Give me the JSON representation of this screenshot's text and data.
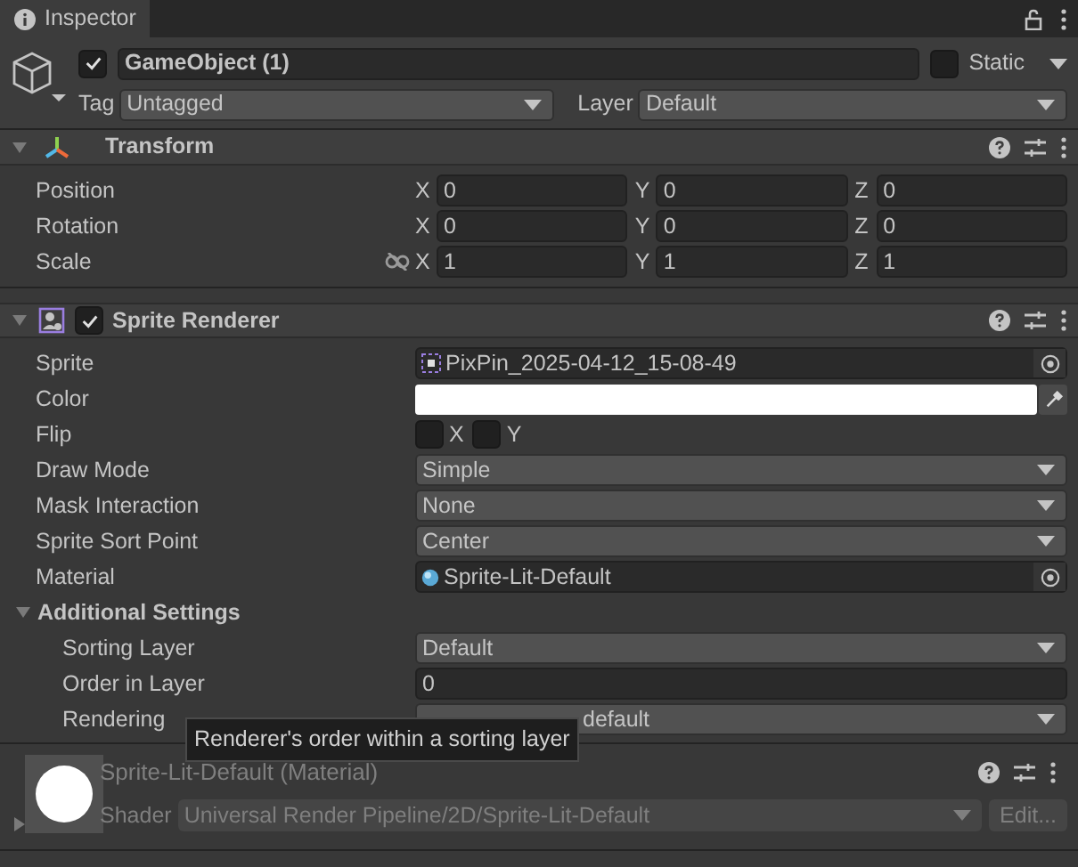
{
  "tab": {
    "title": "Inspector",
    "selected": true
  },
  "object": {
    "active": true,
    "name": "GameObject (1)",
    "static": false,
    "static_label": "Static",
    "tag_label": "Tag",
    "tag": "Untagged",
    "layer_label": "Layer",
    "layer": "Default"
  },
  "transform": {
    "title": "Transform",
    "expanded": true,
    "rows": [
      {
        "label": "Position",
        "linked": false,
        "axes": [
          {
            "axis": "X",
            "value": "0"
          },
          {
            "axis": "Y",
            "value": "0"
          },
          {
            "axis": "Z",
            "value": "0"
          }
        ]
      },
      {
        "label": "Rotation",
        "linked": false,
        "axes": [
          {
            "axis": "X",
            "value": "0"
          },
          {
            "axis": "Y",
            "value": "0"
          },
          {
            "axis": "Z",
            "value": "0"
          }
        ]
      },
      {
        "label": "Scale",
        "linked": true,
        "axes": [
          {
            "axis": "X",
            "value": "1"
          },
          {
            "axis": "Y",
            "value": "1"
          },
          {
            "axis": "Z",
            "value": "1"
          }
        ]
      }
    ]
  },
  "sprite_renderer": {
    "title": "Sprite Renderer",
    "enabled": true,
    "expanded": true,
    "rows": [
      {
        "kind": "object",
        "label": "Sprite",
        "value": "PixPin_2025-04-12_15-08-49"
      },
      {
        "kind": "color",
        "label": "Color",
        "color": "#ffffff"
      },
      {
        "kind": "flip",
        "label": "Flip",
        "toggles": [
          {
            "axis": "X",
            "checked": false
          },
          {
            "axis": "Y",
            "checked": false
          }
        ]
      },
      {
        "kind": "dropdown",
        "label": "Draw Mode",
        "value": "Simple"
      },
      {
        "kind": "dropdown",
        "label": "Mask Interaction",
        "value": "None"
      },
      {
        "kind": "dropdown",
        "label": "Sprite Sort Point",
        "value": "Center"
      },
      {
        "kind": "material",
        "label": "Material",
        "value": "Sprite-Lit-Default"
      },
      {
        "kind": "section",
        "label": "Additional Settings",
        "expanded": true,
        "children": [
          {
            "kind": "dropdown",
            "label": "Sorting Layer",
            "value": "Default"
          },
          {
            "kind": "text",
            "label": "Order in Layer",
            "value": "0"
          },
          {
            "kind": "dropdown",
            "label": "Rendering",
            "value": "default"
          }
        ]
      }
    ]
  },
  "tooltip": "Renderer's order within a sorting layer",
  "material": {
    "title": "Sprite-Lit-Default (Material)",
    "expanded": false,
    "shader_label": "Shader",
    "shader": "Universal Render Pipeline/2D/Sprite-Lit-Default",
    "edit_button": "Edit..."
  }
}
